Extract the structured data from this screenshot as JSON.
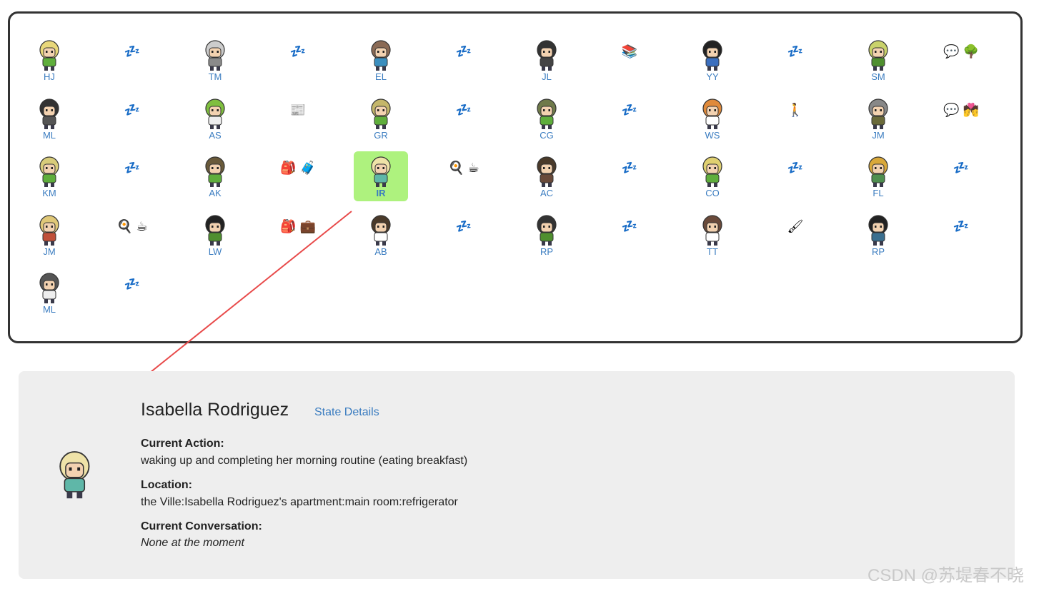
{
  "roster": {
    "agents": [
      {
        "initials": "HJ",
        "hair": "#e8d77a",
        "shirt": "#5fae3c",
        "status": "💤",
        "selected": false
      },
      {
        "initials": "TM",
        "hair": "#cccccc",
        "shirt": "#8a8a8a",
        "status": "💤",
        "selected": false
      },
      {
        "initials": "EL",
        "hair": "#8a6a55",
        "shirt": "#3b8fbf",
        "status": "💤",
        "selected": false
      },
      {
        "initials": "JL",
        "hair": "#333333",
        "shirt": "#444444",
        "status": "📚",
        "selected": false
      },
      {
        "initials": "YY",
        "hair": "#222222",
        "shirt": "#3b6fbf",
        "status": "💤",
        "selected": false
      },
      {
        "initials": "SM",
        "hair": "#c9d26a",
        "shirt": "#4f8f2f",
        "status": "💬 🌳",
        "selected": false
      },
      {
        "initials": "ML",
        "hair": "#333333",
        "shirt": "#555555",
        "status": "💤",
        "selected": false
      },
      {
        "initials": "AS",
        "hair": "#7fbf3f",
        "shirt": "#eeeeee",
        "status": "📰",
        "selected": false
      },
      {
        "initials": "GR",
        "hair": "#c4b66a",
        "shirt": "#5fae3c",
        "status": "💤",
        "selected": false
      },
      {
        "initials": "CG",
        "hair": "#6f7a4a",
        "shirt": "#5fae3c",
        "status": "💤",
        "selected": false
      },
      {
        "initials": "WS",
        "hair": "#e08a3a",
        "shirt": "#ffffff",
        "status": "🚶",
        "selected": false
      },
      {
        "initials": "JM",
        "hair": "#888888",
        "shirt": "#6a6a3a",
        "status": "💬 💏",
        "selected": false
      },
      {
        "initials": "KM",
        "hair": "#d8cc7a",
        "shirt": "#5fae3c",
        "status": "💤",
        "selected": false
      },
      {
        "initials": "AK",
        "hair": "#6a5a3a",
        "shirt": "#5fae3c",
        "status": "🎒 🧳",
        "selected": false
      },
      {
        "initials": "IR",
        "hair": "#efe3a8",
        "shirt": "#5fb7a8",
        "status": "🍳 ☕",
        "selected": true
      },
      {
        "initials": "AC",
        "hair": "#4a3a2a",
        "shirt": "#6a4a3a",
        "status": "💤",
        "selected": false
      },
      {
        "initials": "CO",
        "hair": "#e0d070",
        "shirt": "#5fae3c",
        "status": "💤",
        "selected": false
      },
      {
        "initials": "FL",
        "hair": "#d9a83a",
        "shirt": "#4f8f4f",
        "status": "💤",
        "selected": false
      },
      {
        "initials": "JM",
        "hair": "#e0c878",
        "shirt": "#c0503a",
        "status": "🍳 ☕",
        "selected": false
      },
      {
        "initials": "LW",
        "hair": "#222222",
        "shirt": "#4f8f2f",
        "status": "🎒 💼",
        "selected": false
      },
      {
        "initials": "AB",
        "hair": "#4a3a2a",
        "shirt": "#ffffff",
        "status": "💤",
        "selected": false
      },
      {
        "initials": "RP",
        "hair": "#333333",
        "shirt": "#4f8f2f",
        "status": "💤",
        "selected": false
      },
      {
        "initials": "TT",
        "hair": "#6a4a3a",
        "shirt": "#ffffff",
        "status": "🖌",
        "selected": false
      },
      {
        "initials": "RP",
        "hair": "#222222",
        "shirt": "#3b6f8f",
        "status": "💤",
        "selected": false
      },
      {
        "initials": "ML",
        "hair": "#555555",
        "shirt": "#eeeeee",
        "status": "💤",
        "selected": false
      }
    ]
  },
  "detail": {
    "name": "Isabella Rodriguez",
    "state_details_link": "State Details",
    "current_action_label": "Current Action:",
    "current_action_value": "waking up and completing her morning routine (eating breakfast)",
    "location_label": "Location:",
    "location_value": "the Ville:Isabella Rodriguez's apartment:main room:refrigerator",
    "conversation_label": "Current Conversation:",
    "conversation_value": "None at the moment",
    "avatar_hair": "#efe3a8",
    "avatar_shirt": "#5fb7a8"
  },
  "watermark": "CSDN @苏堤春不晓",
  "colors": {
    "accent_link": "#3a7cc0",
    "selected_bg": "#aef27e",
    "arrow": "#e84a4a"
  }
}
